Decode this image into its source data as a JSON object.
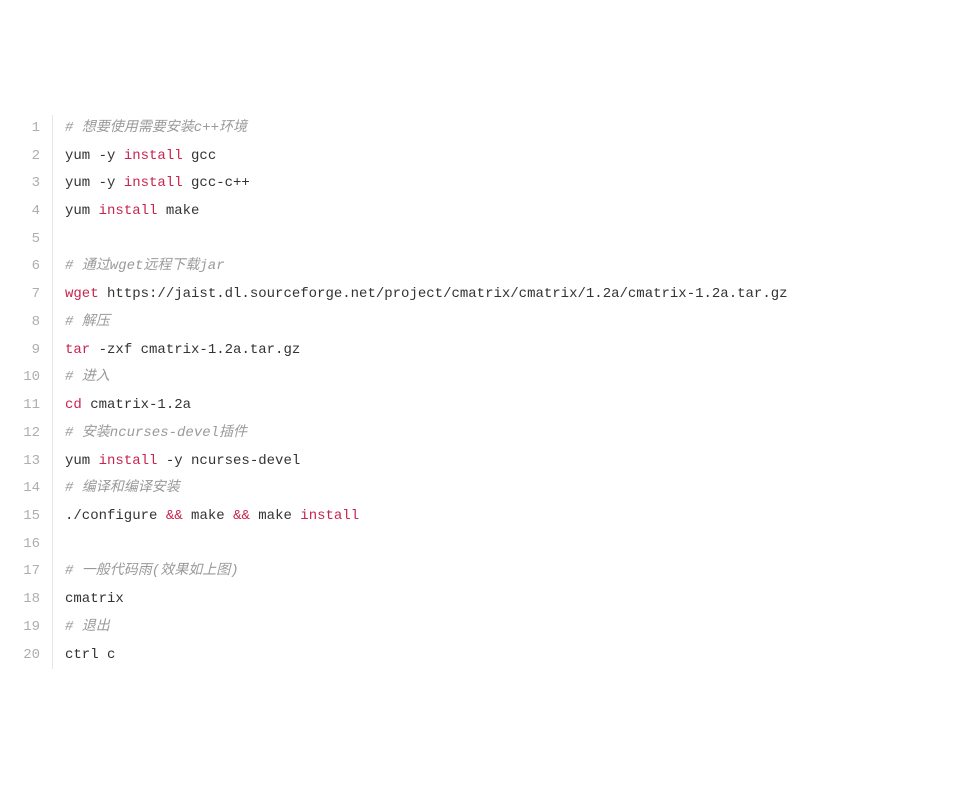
{
  "lines": [
    {
      "num": "1",
      "tokens": [
        {
          "cls": "tok-comment",
          "text": "# 想要使用需要安装c++环境"
        }
      ]
    },
    {
      "num": "2",
      "tokens": [
        {
          "cls": "tok-plain",
          "text": "yum -y "
        },
        {
          "cls": "tok-kw",
          "text": "install"
        },
        {
          "cls": "tok-plain",
          "text": " gcc"
        }
      ]
    },
    {
      "num": "3",
      "tokens": [
        {
          "cls": "tok-plain",
          "text": "yum -y "
        },
        {
          "cls": "tok-kw",
          "text": "install"
        },
        {
          "cls": "tok-plain",
          "text": " gcc-c++"
        }
      ]
    },
    {
      "num": "4",
      "tokens": [
        {
          "cls": "tok-plain",
          "text": "yum "
        },
        {
          "cls": "tok-kw",
          "text": "install"
        },
        {
          "cls": "tok-plain",
          "text": " make"
        }
      ]
    },
    {
      "num": "5",
      "tokens": [
        {
          "cls": "tok-plain",
          "text": ""
        }
      ]
    },
    {
      "num": "6",
      "tokens": [
        {
          "cls": "tok-comment",
          "text": "# 通过wget远程下载jar"
        }
      ]
    },
    {
      "num": "7",
      "tokens": [
        {
          "cls": "tok-kw",
          "text": "wget"
        },
        {
          "cls": "tok-plain",
          "text": " https://jaist.dl.sourceforge.net/project/cmatrix/cmatrix/1.2a/cmatrix-1.2a.tar.gz"
        }
      ]
    },
    {
      "num": "8",
      "tokens": [
        {
          "cls": "tok-comment",
          "text": "# 解压"
        }
      ]
    },
    {
      "num": "9",
      "tokens": [
        {
          "cls": "tok-kw",
          "text": "tar"
        },
        {
          "cls": "tok-plain",
          "text": " -zxf cmatrix-1.2a.tar.gz"
        }
      ]
    },
    {
      "num": "10",
      "tokens": [
        {
          "cls": "tok-comment",
          "text": "# 进入"
        }
      ]
    },
    {
      "num": "11",
      "tokens": [
        {
          "cls": "tok-kw",
          "text": "cd"
        },
        {
          "cls": "tok-plain",
          "text": " cmatrix-1.2a"
        }
      ]
    },
    {
      "num": "12",
      "tokens": [
        {
          "cls": "tok-comment",
          "text": "# 安装ncurses-devel插件"
        }
      ]
    },
    {
      "num": "13",
      "tokens": [
        {
          "cls": "tok-plain",
          "text": "yum "
        },
        {
          "cls": "tok-kw",
          "text": "install"
        },
        {
          "cls": "tok-plain",
          "text": " -y ncurses-devel"
        }
      ]
    },
    {
      "num": "14",
      "tokens": [
        {
          "cls": "tok-comment",
          "text": "# 编译和编译安装"
        }
      ]
    },
    {
      "num": "15",
      "tokens": [
        {
          "cls": "tok-plain",
          "text": "./configure "
        },
        {
          "cls": "tok-kw",
          "text": "&&"
        },
        {
          "cls": "tok-plain",
          "text": " make "
        },
        {
          "cls": "tok-kw",
          "text": "&&"
        },
        {
          "cls": "tok-plain",
          "text": " make "
        },
        {
          "cls": "tok-kw",
          "text": "install"
        }
      ]
    },
    {
      "num": "16",
      "tokens": [
        {
          "cls": "tok-plain",
          "text": ""
        }
      ]
    },
    {
      "num": "17",
      "tokens": [
        {
          "cls": "tok-comment",
          "text": "# 一般代码雨(效果如上图)"
        }
      ]
    },
    {
      "num": "18",
      "tokens": [
        {
          "cls": "tok-plain",
          "text": "cmatrix"
        }
      ]
    },
    {
      "num": "19",
      "tokens": [
        {
          "cls": "tok-comment",
          "text": "# 退出"
        }
      ]
    },
    {
      "num": "20",
      "tokens": [
        {
          "cls": "tok-plain",
          "text": "ctrl c"
        }
      ]
    }
  ]
}
